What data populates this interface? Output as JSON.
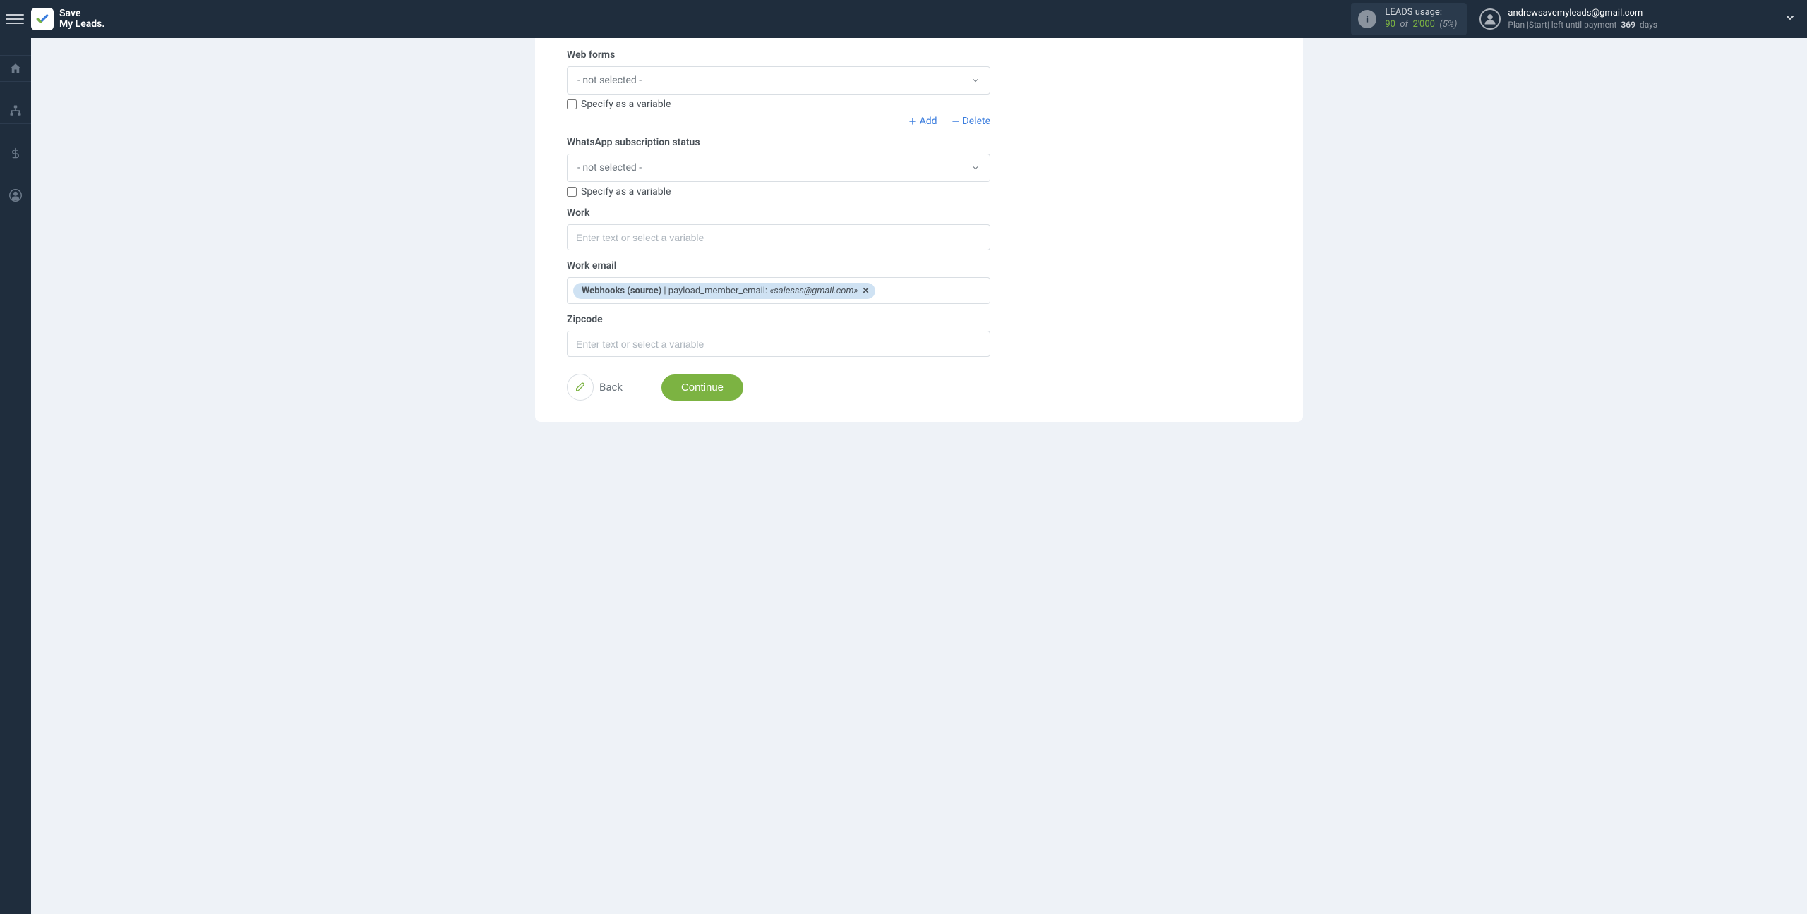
{
  "header": {
    "logo_line1": "Save",
    "logo_line2": "My Leads.",
    "leads_label": "LEADS usage:",
    "leads_current": "90",
    "leads_of": "of",
    "leads_total": "2'000",
    "leads_percent": "(5%)",
    "user_email": "andrewsavemyleads@gmail.com",
    "plan_prefix": "Plan |",
    "plan_name": "Start",
    "plan_middle": "| left until payment",
    "plan_days": "369",
    "plan_days_suffix": "days"
  },
  "form": {
    "web_forms": {
      "label": "Web forms",
      "value": "- not selected -",
      "specify_label": "Specify as a variable"
    },
    "add_label": "Add",
    "delete_label": "Delete",
    "whatsapp": {
      "label": "WhatsApp subscription status",
      "value": "- not selected -",
      "specify_label": "Specify as a variable"
    },
    "work": {
      "label": "Work",
      "placeholder": "Enter text or select a variable"
    },
    "work_email": {
      "label": "Work email",
      "tag_source": "Webhooks (source)",
      "tag_sep": " | ",
      "tag_field": "payload_member_email: ",
      "tag_value": "«salesss@gmail.com»"
    },
    "zipcode": {
      "label": "Zipcode",
      "placeholder": "Enter text or select a variable"
    },
    "back_label": "Back",
    "continue_label": "Continue"
  }
}
